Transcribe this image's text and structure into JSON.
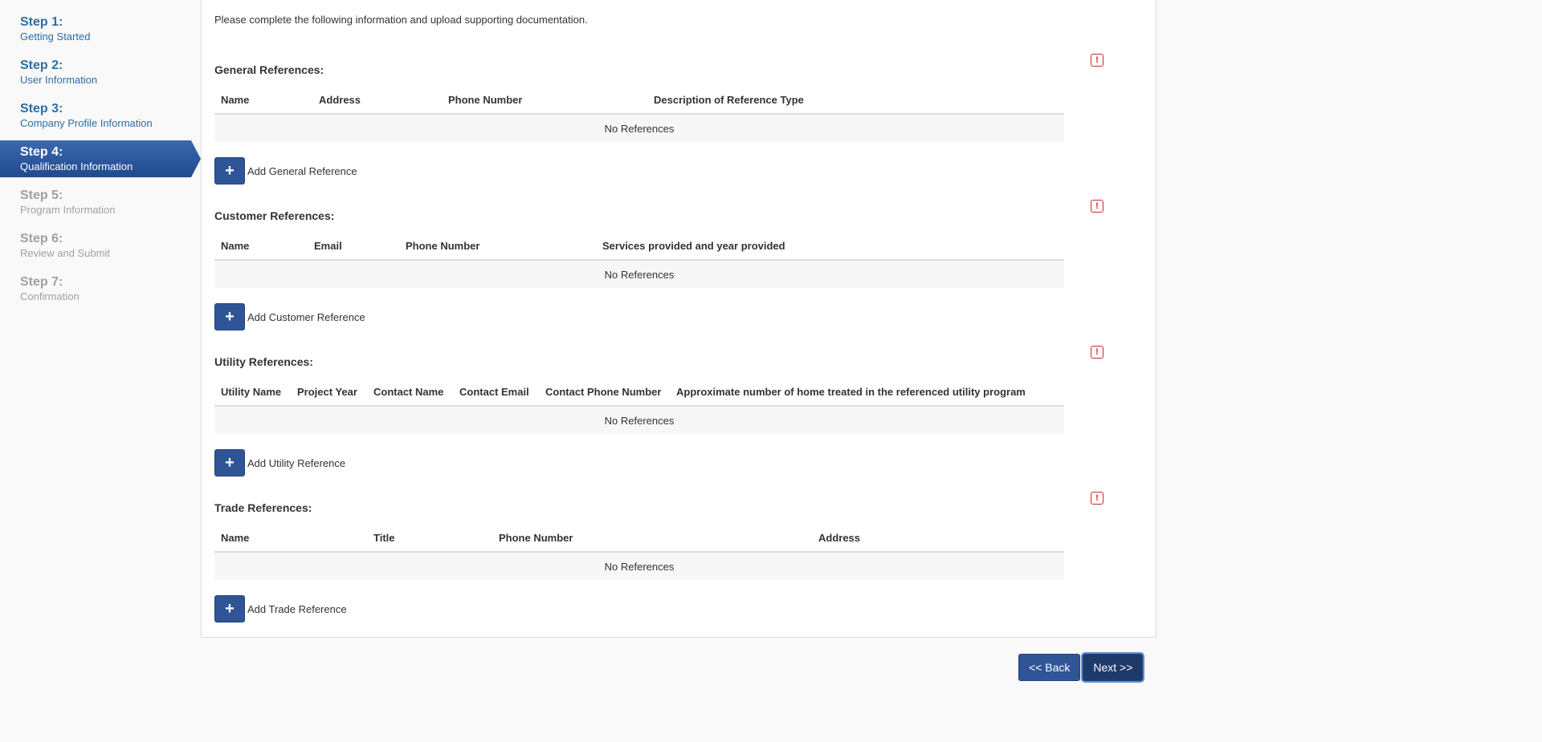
{
  "steps": [
    {
      "num": "Step 1:",
      "label": "Getting Started",
      "state": "done"
    },
    {
      "num": "Step 2:",
      "label": "User Information",
      "state": "done"
    },
    {
      "num": "Step 3:",
      "label": "Company Profile Information",
      "state": "done"
    },
    {
      "num": "Step 4:",
      "label": "Qualification Information",
      "state": "active"
    },
    {
      "num": "Step 5:",
      "label": "Program Information",
      "state": "future"
    },
    {
      "num": "Step 6:",
      "label": "Review and Submit",
      "state": "future"
    },
    {
      "num": "Step 7:",
      "label": "Confirmation",
      "state": "future"
    }
  ],
  "intro": "Please complete the following information and upload supporting documentation.",
  "sections": {
    "general": {
      "title": "General References:",
      "columns": [
        "Name",
        "Address",
        "Phone Number",
        "Description of Reference Type"
      ],
      "empty": "No References",
      "add_label": "Add General Reference"
    },
    "customer": {
      "title": "Customer References:",
      "columns": [
        "Name",
        "Email",
        "Phone Number",
        "Services provided and year provided"
      ],
      "empty": "No References",
      "add_label": "Add Customer Reference"
    },
    "utility": {
      "title": "Utility References:",
      "columns": [
        "Utility Name",
        "Project Year",
        "Contact Name",
        "Contact Email",
        "Contact Phone Number",
        "Approximate number of home treated in the referenced utility program"
      ],
      "empty": "No References",
      "add_label": "Add Utility Reference"
    },
    "trade": {
      "title": "Trade References:",
      "columns": [
        "Name",
        "Title",
        "Phone Number",
        "Address"
      ],
      "empty": "No References",
      "add_label": "Add Trade Reference"
    }
  },
  "icons": {
    "alert": "!",
    "plus": "+"
  },
  "buttons": {
    "back": "<< Back",
    "next": "Next >>"
  },
  "colors": {
    "accent": "#2f5597",
    "step_done": "#2e6da4",
    "step_future": "#a0a0a0",
    "alert": "#cc2a2a"
  }
}
